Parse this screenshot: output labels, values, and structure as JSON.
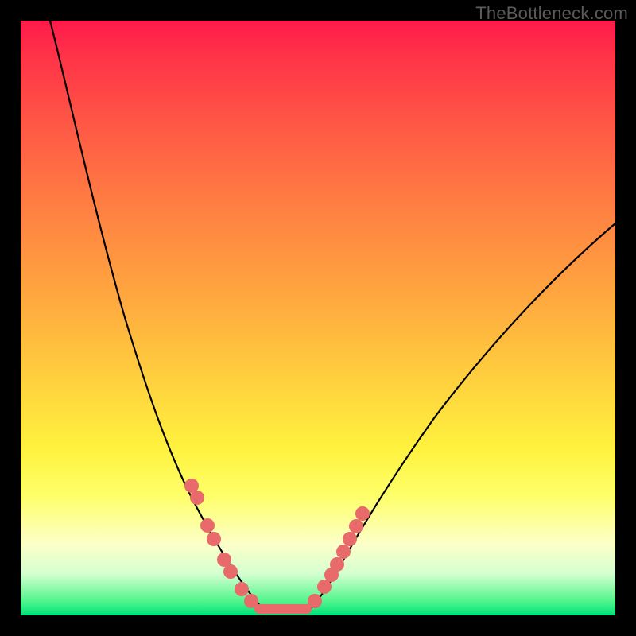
{
  "watermark": "TheBottleneck.com",
  "colors": {
    "frame_bg": "#000000",
    "curve": "#000000",
    "dots": "#e86a6a",
    "gradient_top": "#ff1a4a",
    "gradient_bottom": "#00e27a"
  },
  "chart_data": {
    "type": "line",
    "title": "",
    "xlabel": "",
    "ylabel": "",
    "xlim": [
      0,
      100
    ],
    "ylim": [
      0,
      100
    ],
    "note": "V-shaped bottleneck curve; y-axis inverted visually (100 at top → red, 0 at bottom → green). Values read from the plotted black curves.",
    "series": [
      {
        "name": "left-arm",
        "x": [
          5,
          10,
          15,
          20,
          25,
          28,
          30,
          32,
          34,
          36,
          38,
          40
        ],
        "values": [
          100,
          82,
          62,
          44,
          30,
          22,
          17,
          13,
          9,
          6,
          3,
          1
        ]
      },
      {
        "name": "right-arm",
        "x": [
          48,
          50,
          52,
          54,
          56,
          60,
          65,
          70,
          80,
          90,
          100
        ],
        "values": [
          1,
          3,
          6,
          10,
          14,
          20,
          26,
          32,
          44,
          55,
          66
        ]
      }
    ],
    "flat_minimum": {
      "x_start": 40,
      "x_end": 48,
      "value": 1
    },
    "highlighted_points": {
      "note": "salmon circular markers overlaid on the curve in the lower region",
      "left_cluster": [
        {
          "x": 28,
          "y": 22
        },
        {
          "x": 29,
          "y": 20
        },
        {
          "x": 31,
          "y": 15
        },
        {
          "x": 32,
          "y": 13
        },
        {
          "x": 34,
          "y": 9
        },
        {
          "x": 35,
          "y": 7
        },
        {
          "x": 37,
          "y": 4
        },
        {
          "x": 39,
          "y": 2
        }
      ],
      "right_cluster": [
        {
          "x": 49,
          "y": 2
        },
        {
          "x": 51,
          "y": 5
        },
        {
          "x": 52,
          "y": 7
        },
        {
          "x": 53,
          "y": 9
        },
        {
          "x": 54,
          "y": 11
        },
        {
          "x": 55,
          "y": 13
        },
        {
          "x": 56,
          "y": 15
        },
        {
          "x": 57,
          "y": 17
        }
      ]
    }
  }
}
